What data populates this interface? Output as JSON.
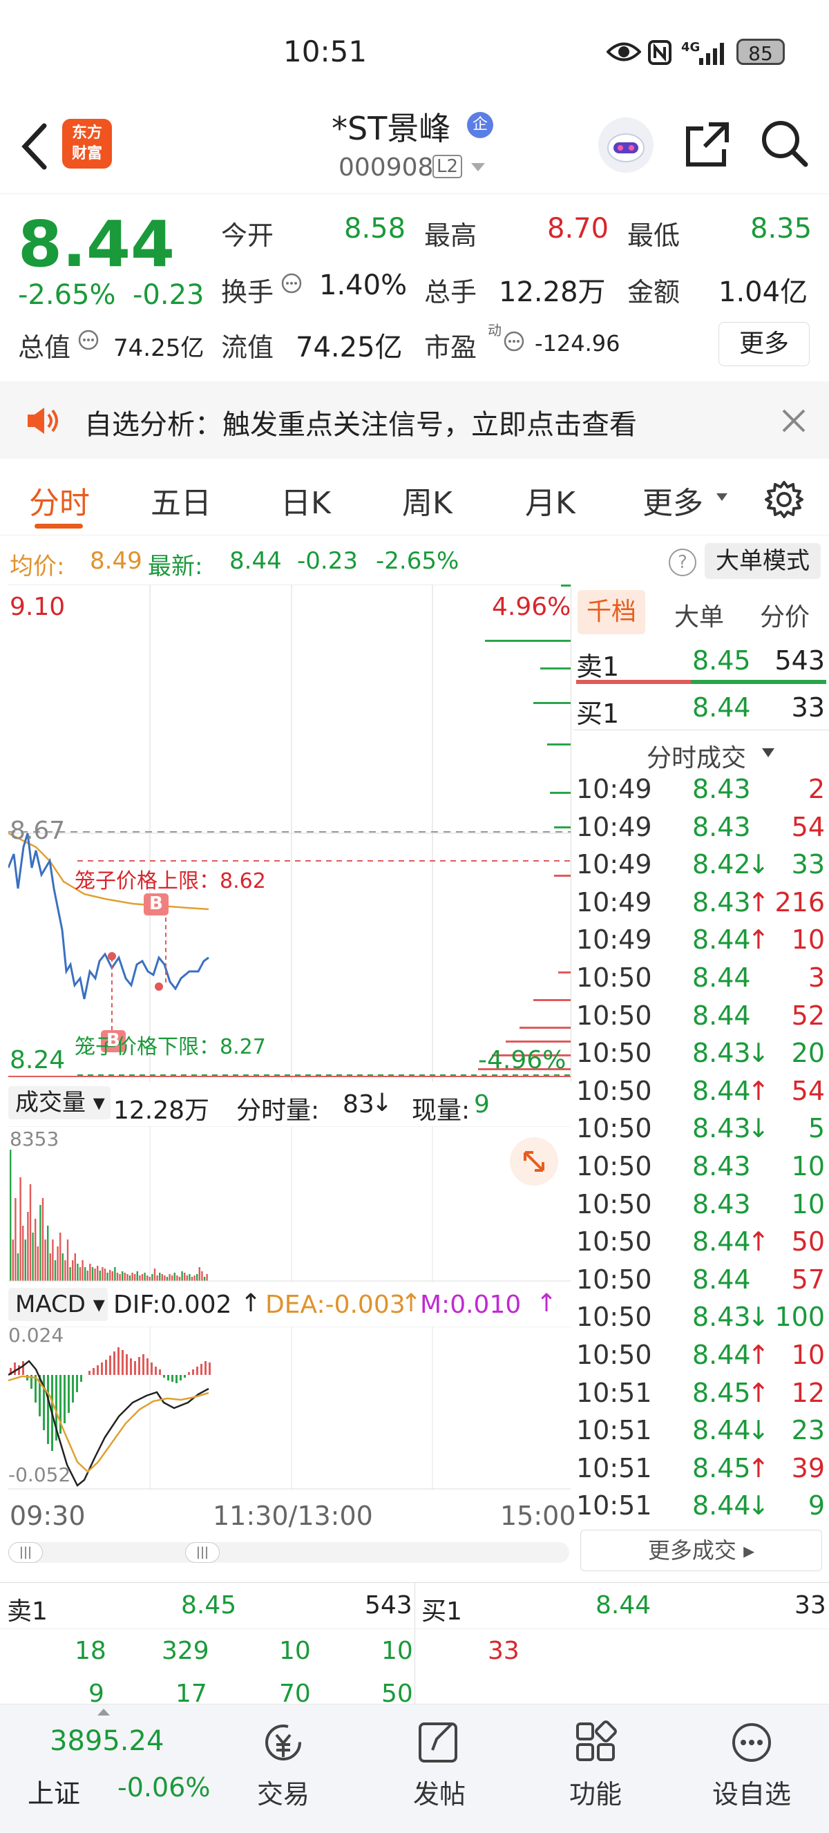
{
  "status_bar": {
    "time": "10:51",
    "signal": "4G",
    "battery": "85"
  },
  "header": {
    "logo_line1": "东方",
    "logo_line2": "财富",
    "title": "*ST景峰",
    "badge": "企",
    "code": "000908",
    "level": "L2"
  },
  "quote": {
    "price": "8.44",
    "change_pct": "-2.65%",
    "change": "-0.23",
    "open_label": "今开",
    "open": "8.58",
    "high_label": "最高",
    "high": "8.70",
    "low_label": "最低",
    "low": "8.35",
    "turnover_label": "换手",
    "turnover": "1.40%",
    "vol_label": "总手",
    "vol": "12.28万",
    "amount_label": "金额",
    "amount": "1.04亿",
    "mcap_label": "总值",
    "mcap": "74.25亿",
    "float_label": "流值",
    "float": "74.25亿",
    "pe_label": "市盈",
    "pe_sup": "动",
    "pe": "-124.96",
    "more": "更多"
  },
  "notice": {
    "text": "自选分析：触发重点关注信号，立即点击查看"
  },
  "tabs": [
    "分时",
    "五日",
    "日K",
    "周K",
    "月K",
    "更多"
  ],
  "infobar": {
    "avg_label": "均价:",
    "avg": "8.49",
    "last_label": "最新:",
    "last": "8.44",
    "chg": "-0.23",
    "pct": "-2.65%",
    "mode": "大单模式"
  },
  "chart": {
    "y_top": "9.10",
    "y_bottom": "8.24",
    "pct_top": "4.96%",
    "pct_bottom": "-4.96%",
    "ref": "8.67",
    "cage_upper": "笼子价格上限：8.62",
    "cage_lower": "笼子价格下限：8.27",
    "marker_b": "B",
    "marker_s": "B"
  },
  "volume": {
    "label": "成交量",
    "total": "12.28万",
    "tick_label": "分时量:",
    "tick": "83",
    "now_label": "现量:",
    "now": "9",
    "max": "8353"
  },
  "macd": {
    "label": "MACD",
    "dif": "DIF:0.002",
    "dea": "DEA:-0.003",
    "m": "M:0.010",
    "top": "0.024",
    "bottom": "-0.052"
  },
  "time_axis": [
    "09:30",
    "11:30/13:00",
    "15:00"
  ],
  "orderbook": {
    "tabs": [
      "千档",
      "大单",
      "分价"
    ],
    "sell1_label": "卖1",
    "sell1_price": "8.45",
    "sell1_qty": "543",
    "buy1_label": "买1",
    "buy1_price": "8.44",
    "buy1_qty": "33",
    "trades_title": "分时成交",
    "trades": [
      {
        "t": "10:49",
        "p": "8.43",
        "a": "",
        "q": "2",
        "c": "red"
      },
      {
        "t": "10:49",
        "p": "8.43",
        "a": "",
        "q": "54",
        "c": "red"
      },
      {
        "t": "10:49",
        "p": "8.42",
        "a": "↓",
        "q": "33",
        "c": "green"
      },
      {
        "t": "10:49",
        "p": "8.43",
        "a": "↑",
        "q": "216",
        "c": "red"
      },
      {
        "t": "10:49",
        "p": "8.44",
        "a": "↑",
        "q": "10",
        "c": "red"
      },
      {
        "t": "10:50",
        "p": "8.44",
        "a": "",
        "q": "3",
        "c": "red"
      },
      {
        "t": "10:50",
        "p": "8.44",
        "a": "",
        "q": "52",
        "c": "red"
      },
      {
        "t": "10:50",
        "p": "8.43",
        "a": "↓",
        "q": "20",
        "c": "green"
      },
      {
        "t": "10:50",
        "p": "8.44",
        "a": "↑",
        "q": "54",
        "c": "red"
      },
      {
        "t": "10:50",
        "p": "8.43",
        "a": "↓",
        "q": "5",
        "c": "green"
      },
      {
        "t": "10:50",
        "p": "8.43",
        "a": "",
        "q": "10",
        "c": "green"
      },
      {
        "t": "10:50",
        "p": "8.43",
        "a": "",
        "q": "10",
        "c": "green"
      },
      {
        "t": "10:50",
        "p": "8.44",
        "a": "↑",
        "q": "50",
        "c": "red"
      },
      {
        "t": "10:50",
        "p": "8.44",
        "a": "",
        "q": "57",
        "c": "red"
      },
      {
        "t": "10:50",
        "p": "8.43",
        "a": "↓",
        "q": "100",
        "c": "green"
      },
      {
        "t": "10:50",
        "p": "8.44",
        "a": "↑",
        "q": "10",
        "c": "red"
      },
      {
        "t": "10:51",
        "p": "8.45",
        "a": "↑",
        "q": "12",
        "c": "red"
      },
      {
        "t": "10:51",
        "p": "8.44",
        "a": "↓",
        "q": "23",
        "c": "green"
      },
      {
        "t": "10:51",
        "p": "8.45",
        "a": "↑",
        "q": "39",
        "c": "red"
      },
      {
        "t": "10:51",
        "p": "8.44",
        "a": "↓",
        "q": "9",
        "c": "green"
      }
    ],
    "more_trades": "更多成交"
  },
  "bottom_book": {
    "sell_label": "卖1",
    "sell_price": "8.45",
    "sell_qty": "543",
    "buy_label": "买1",
    "buy_price": "8.44",
    "buy_qty": "33",
    "sell_row1": [
      "18",
      "329",
      "10",
      "10"
    ],
    "sell_row2": [
      "9",
      "17",
      "70",
      "50"
    ],
    "buy_row1": [
      "33"
    ]
  },
  "nav": {
    "index_val": "3895.24",
    "index_name": "上证",
    "index_chg": "-0.06%",
    "items": [
      "交易",
      "发帖",
      "功能",
      "设自选"
    ]
  }
}
